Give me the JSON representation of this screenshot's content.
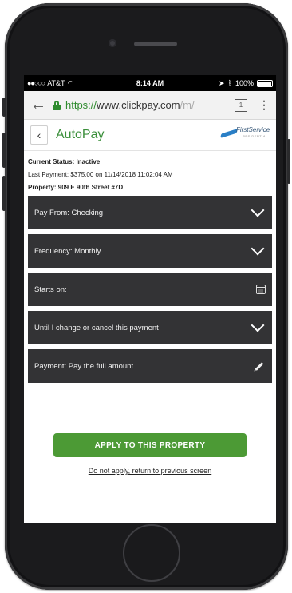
{
  "status_bar": {
    "carrier": "AT&T",
    "time": "8:14 AM",
    "battery": "100%"
  },
  "browser": {
    "url_scheme": "https://",
    "url_host": "www.clickpay.com",
    "url_rest": "/m/",
    "tab_count": "1"
  },
  "app": {
    "title": "AutoPay",
    "logo_text": "FirstService",
    "logo_sub": "RESIDENTIAL"
  },
  "info": {
    "status": "Current Status: Inactive",
    "last_payment": "Last Payment: $375.00 on 11/14/2018 11:02:04 AM",
    "property": "Property: 909 E 90th Street #7D"
  },
  "panels": {
    "pay_from": "Pay From: Checking",
    "frequency": "Frequency: Monthly",
    "starts_on": "Starts on:",
    "until": "Until I change or cancel this payment",
    "payment": "Payment: Pay the full amount"
  },
  "actions": {
    "apply": "APPLY TO THIS PROPERTY",
    "skip": "Do not apply, return to previous screen"
  },
  "icons": {
    "back": "chevron-left-icon",
    "lock": "lock-icon",
    "dropdown": "chevron-down-icon",
    "calendar": "calendar-icon",
    "edit": "pencil-icon"
  },
  "colors": {
    "accent_green": "#4c9a35",
    "title_green": "#3b8f3b",
    "panel_bg": "#333335"
  }
}
